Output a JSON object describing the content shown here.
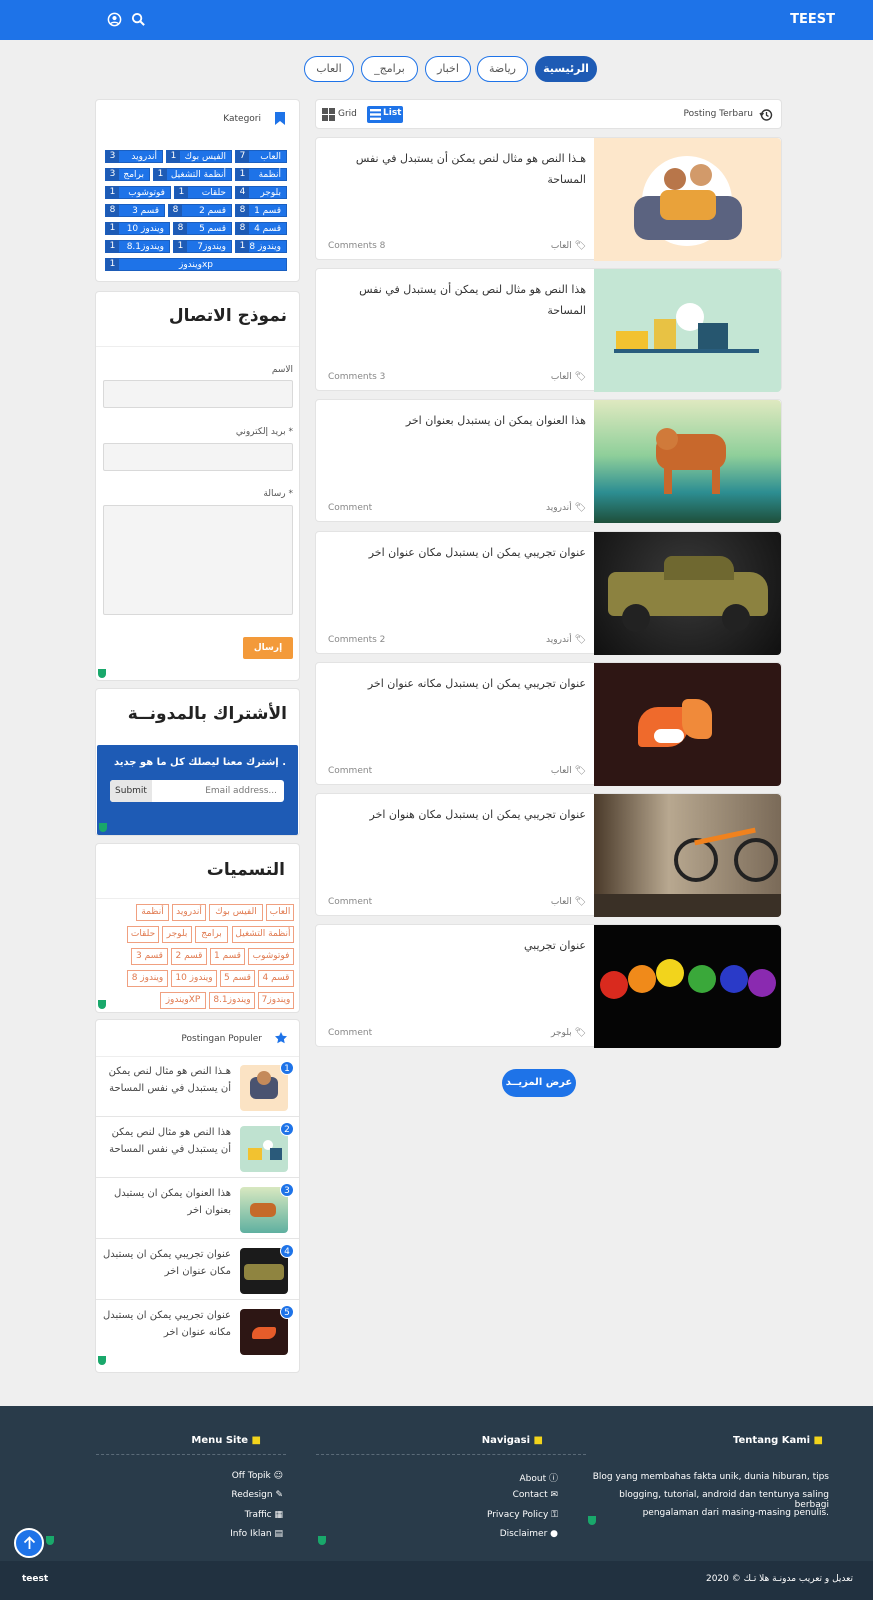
{
  "header": {
    "brand": "TEEST"
  },
  "tabs": [
    "الرئيسية",
    "رياضة",
    "اخبار",
    "_برامج",
    "العاب"
  ],
  "categories_widget": {
    "title": "Kategori",
    "items": [
      {
        "label": "العاب",
        "count": "7"
      },
      {
        "label": "الفيس بوك",
        "count": "1"
      },
      {
        "label": "أندرويد",
        "count": "3"
      },
      {
        "label": "أنظمة",
        "count": "1"
      },
      {
        "label": "أنظمة التشغيل",
        "count": "1"
      },
      {
        "label": "برامج",
        "count": "3"
      },
      {
        "label": "بلوجر",
        "count": "4"
      },
      {
        "label": "حلقات",
        "count": "1"
      },
      {
        "label": "فوتوشوب",
        "count": "1"
      },
      {
        "label": "قسم 1",
        "count": "8"
      },
      {
        "label": "قسم 2",
        "count": "8"
      },
      {
        "label": "قسم 3",
        "count": "8"
      },
      {
        "label": "قسم 4",
        "count": "8"
      },
      {
        "label": "قسم 5",
        "count": "8"
      },
      {
        "label": "ويندوز 10",
        "count": "1"
      },
      {
        "label": "ويندوز 8",
        "count": "1"
      },
      {
        "label": "ويندوز7",
        "count": "1"
      },
      {
        "label": "ويندوز8.1",
        "count": "1"
      },
      {
        "label": "ويندوزxp",
        "count": "1"
      }
    ]
  },
  "contact": {
    "title": "نموذج الاتصال",
    "name_label": "الاسم",
    "email_label": "بريد إلكتروني *",
    "message_label": "رسالة *",
    "send": "إرسال"
  },
  "subscribe": {
    "title": "الأشتراك بالمدونــة",
    "text": "إشترك معنا ليصلك كل ما هو جديد .",
    "placeholder": "Email address...",
    "submit": "Submit"
  },
  "labels_widget": {
    "title": "التسميات",
    "tags": [
      "العاب",
      "الفيس بوك",
      "أندرويد",
      "أنظمة",
      "أنظمة التشغيل",
      "برامج",
      "بلوجر",
      "حلقات",
      "فوتوشوب",
      "قسم 1",
      "قسم 2",
      "قسم 3",
      "قسم 4",
      "قسم 5",
      "ويندوز 10",
      "ويندوز 8",
      "ويندوز7",
      "ويندوز8.1",
      "ويندوزXP"
    ]
  },
  "popular": {
    "title": "Postingan Populer",
    "items": [
      {
        "rank": "1",
        "title": "هـذا النص هو مثال لنص يمكن أن يستبدل في نفس المساحة"
      },
      {
        "rank": "2",
        "title": "هذا النص هو مثال لنص يمكن أن يستبدل في نفس المساحة"
      },
      {
        "rank": "3",
        "title": "هذا العنوان يمكن ان يستبدل بعنوان اخر"
      },
      {
        "rank": "4",
        "title": "عنوان تجريبي يمكن ان يستبدل مكان عنوان اخر"
      },
      {
        "rank": "5",
        "title": "عنوان تجريبي يمكن ان يستبدل مكانه عنوان اخر"
      }
    ]
  },
  "posts_header": {
    "title": "Posting Terbaru",
    "grid": "Grid",
    "list": "List"
  },
  "posts": [
    {
      "title": "هـذا النص هو مثال لنص يمكن أن يستبدل في نفس المساحة",
      "category": "العاب",
      "comments": "Comments 8"
    },
    {
      "title": "هذا النص هو مثال لنص يمكن أن يستبدل في نفس المساحة",
      "category": "العاب",
      "comments": "Comments 3"
    },
    {
      "title": "هذا العنوان يمكن ان يستبدل بعنوان اخر",
      "category": "أندرويد",
      "comments": "Comment"
    },
    {
      "title": "عنوان تجريبي يمكن ان يستبدل مكان عنوان اخر",
      "category": "أندرويد",
      "comments": "Comments 2"
    },
    {
      "title": "عنوان تجريبي يمكن ان يستبدل مكانه عنوان اخر",
      "category": "العاب",
      "comments": "Comment"
    },
    {
      "title": "عنوان تجريبي يمكن ان يستبدل مكان هنوان اخر",
      "category": "العاب",
      "comments": "Comment"
    },
    {
      "title": "عنوان تجريبي",
      "category": "بلوجر",
      "comments": "Comment"
    }
  ],
  "load_more": "عرض المزيــد",
  "footer": {
    "menu_site": {
      "title": "Menu Site",
      "links": [
        "Off Topik",
        "Redesign",
        "Traffic",
        "Info Iklan"
      ]
    },
    "navigasi": {
      "title": "Navigasi",
      "links": [
        "About",
        "Contact",
        "Privacy Policy",
        "Disclaimer"
      ]
    },
    "tentang": {
      "title": "Tentang Kami",
      "lines": [
        "Blog yang membahas fakta unik, dunia hiburan, tips",
        "blogging, tutorial, android dan tentunya saling berbagi",
        "pengalaman dari masing-masing penulis."
      ]
    },
    "copyright": "تعديل و تعريب مدونـة هلا تـك © 2020",
    "brand": "teest"
  }
}
